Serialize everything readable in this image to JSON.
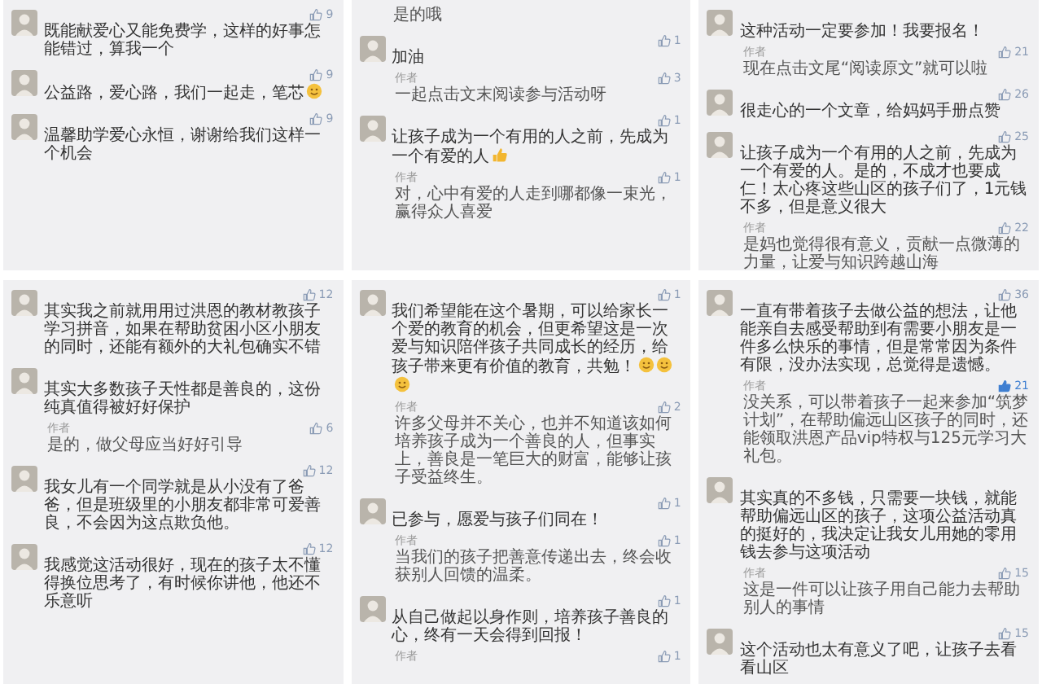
{
  "panels": [
    {
      "comments": [
        {
          "likes": "9",
          "liked": false,
          "text": "既能献爱心又能免费学，这样的好事怎能错过，算我一个"
        },
        {
          "likes": "9",
          "liked": false,
          "text": "公益路，爱心路，我们一起走，笔芯",
          "emojis": [
            {
              "kind": "smile"
            }
          ]
        },
        {
          "likes": "9",
          "liked": false,
          "text": "温馨助学爱心永恒，谢谢给我们这样一个机会"
        }
      ]
    },
    {
      "leading_text": "是的哦",
      "comments": [
        {
          "likes": "1",
          "liked": false,
          "text": "加油",
          "replies": [
            {
              "label": "作者",
              "likes": "3",
              "liked": false,
              "text": "一起点击文末阅读参与活动呀"
            }
          ]
        },
        {
          "likes": "1",
          "liked": false,
          "text": "让孩子成为一个有用的人之前，先成为一个有爱的人",
          "emojis": [
            {
              "kind": "thumb"
            }
          ],
          "replies": [
            {
              "label": "作者",
              "likes": "1",
              "liked": false,
              "text": "对，心中有爱的人走到哪都像一束光，赢得众人喜爱"
            }
          ]
        }
      ]
    },
    {
      "comments": [
        {
          "text": "这种活动一定要参加！我要报名！",
          "replies": [
            {
              "label": "作者",
              "likes": "21",
              "liked": false,
              "text": "现在点击文尾“阅读原文”就可以啦"
            }
          ]
        },
        {
          "likes": "26",
          "liked": false,
          "text": "很走心的一个文章，给妈妈手册点赞"
        },
        {
          "likes": "25",
          "liked": false,
          "text": "让孩子成为一个有用的人之前，先成为一个有爱的人。是的，不成才也要成仁！太心疼这些山区的孩子们了，1元钱不多，但是意义很大",
          "replies": [
            {
              "label": "作者",
              "likes": "22",
              "liked": false,
              "text": "是妈也觉得很有意义，贡献一点微薄的力量，让爱与知识跨越山海"
            }
          ]
        }
      ]
    },
    {
      "comments": [
        {
          "likes": "12",
          "liked": false,
          "text": "其实我之前就用用过洪恩的教材教孩子学习拼音，如果在帮助贫困小区小朋友的同时，还能有额外的大礼包确实不错"
        },
        {
          "text": "其实大多数孩子天性都是善良的，这份纯真值得被好好保护",
          "replies": [
            {
              "label": "作者",
              "likes": "6",
              "liked": false,
              "text": "是的，做父母应当好好引导"
            }
          ]
        },
        {
          "likes": "12",
          "liked": false,
          "text": "我女儿有一个同学就是从小没有了爸爸，但是班级里的小朋友都非常可爱善良，不会因为这点欺负他。"
        },
        {
          "likes": "12",
          "liked": false,
          "text": "我感觉这活动很好，现在的孩子太不懂得换位思考了，有时候你讲他，他还不乐意听"
        }
      ]
    },
    {
      "comments": [
        {
          "likes": "1",
          "liked": false,
          "text": "我们希望能在这个暑期，可以给家长一个爱的教育的机会，但更希望这是一次爱与知识陪伴孩子共同成长的经历，给孩子带来更有价值的教育，共勉！",
          "emojis": [
            {
              "kind": "smile"
            },
            {
              "kind": "smile"
            },
            {
              "kind": "smile"
            }
          ],
          "replies": [
            {
              "label": "作者",
              "likes": "2",
              "liked": false,
              "text": "许多父母并不关心，也并不知道该如何培养孩子成为一个善良的人，但事实上，善良是一笔巨大的财富，能够让孩子受益终生。"
            }
          ]
        },
        {
          "likes": "1",
          "liked": false,
          "text": "已参与，愿爱与孩子们同在！",
          "replies": [
            {
              "label": "作者",
              "likes": "1",
              "liked": false,
              "text": "当我们的孩子把善意传递出去，终会收获别人回馈的温柔。"
            }
          ]
        },
        {
          "likes": "1",
          "liked": false,
          "text": "从自己做起以身作则，培养孩子善良的心，终有一天会得到回报！",
          "replies": [
            {
              "label": "作者",
              "likes": "1",
              "liked": false
            }
          ]
        }
      ]
    },
    {
      "comments": [
        {
          "likes": "36",
          "liked": false,
          "text": "一直有带着孩子去做公益的想法，让他能亲自去感受帮助到有需要小朋友是一件多么快乐的事情，但是常常因为条件有限，没办法实现，总觉得是遗憾。",
          "replies": [
            {
              "label": "作者",
              "likes": "21",
              "liked": true,
              "text": "没关系，可以带着孩子一起来参加“筑梦计划”，在帮助偏远山区孩子的同时，还能领取洪恩产品vip特权与125元学习大礼包。"
            }
          ]
        },
        {
          "text": "其实真的不多钱，只需要一块钱，就能帮助偏远山区的孩子，这项公益活动真的挺好的，我决定让我女儿用她的零用钱去参与这项活动",
          "replies": [
            {
              "label": "作者",
              "likes": "15",
              "liked": false,
              "text": "这是一件可以让孩子用自己能力去帮助别人的事情"
            }
          ]
        },
        {
          "likes": "15",
          "liked": false,
          "text": "这个活动也太有意义了吧，让孩子去看看山区"
        }
      ]
    }
  ]
}
